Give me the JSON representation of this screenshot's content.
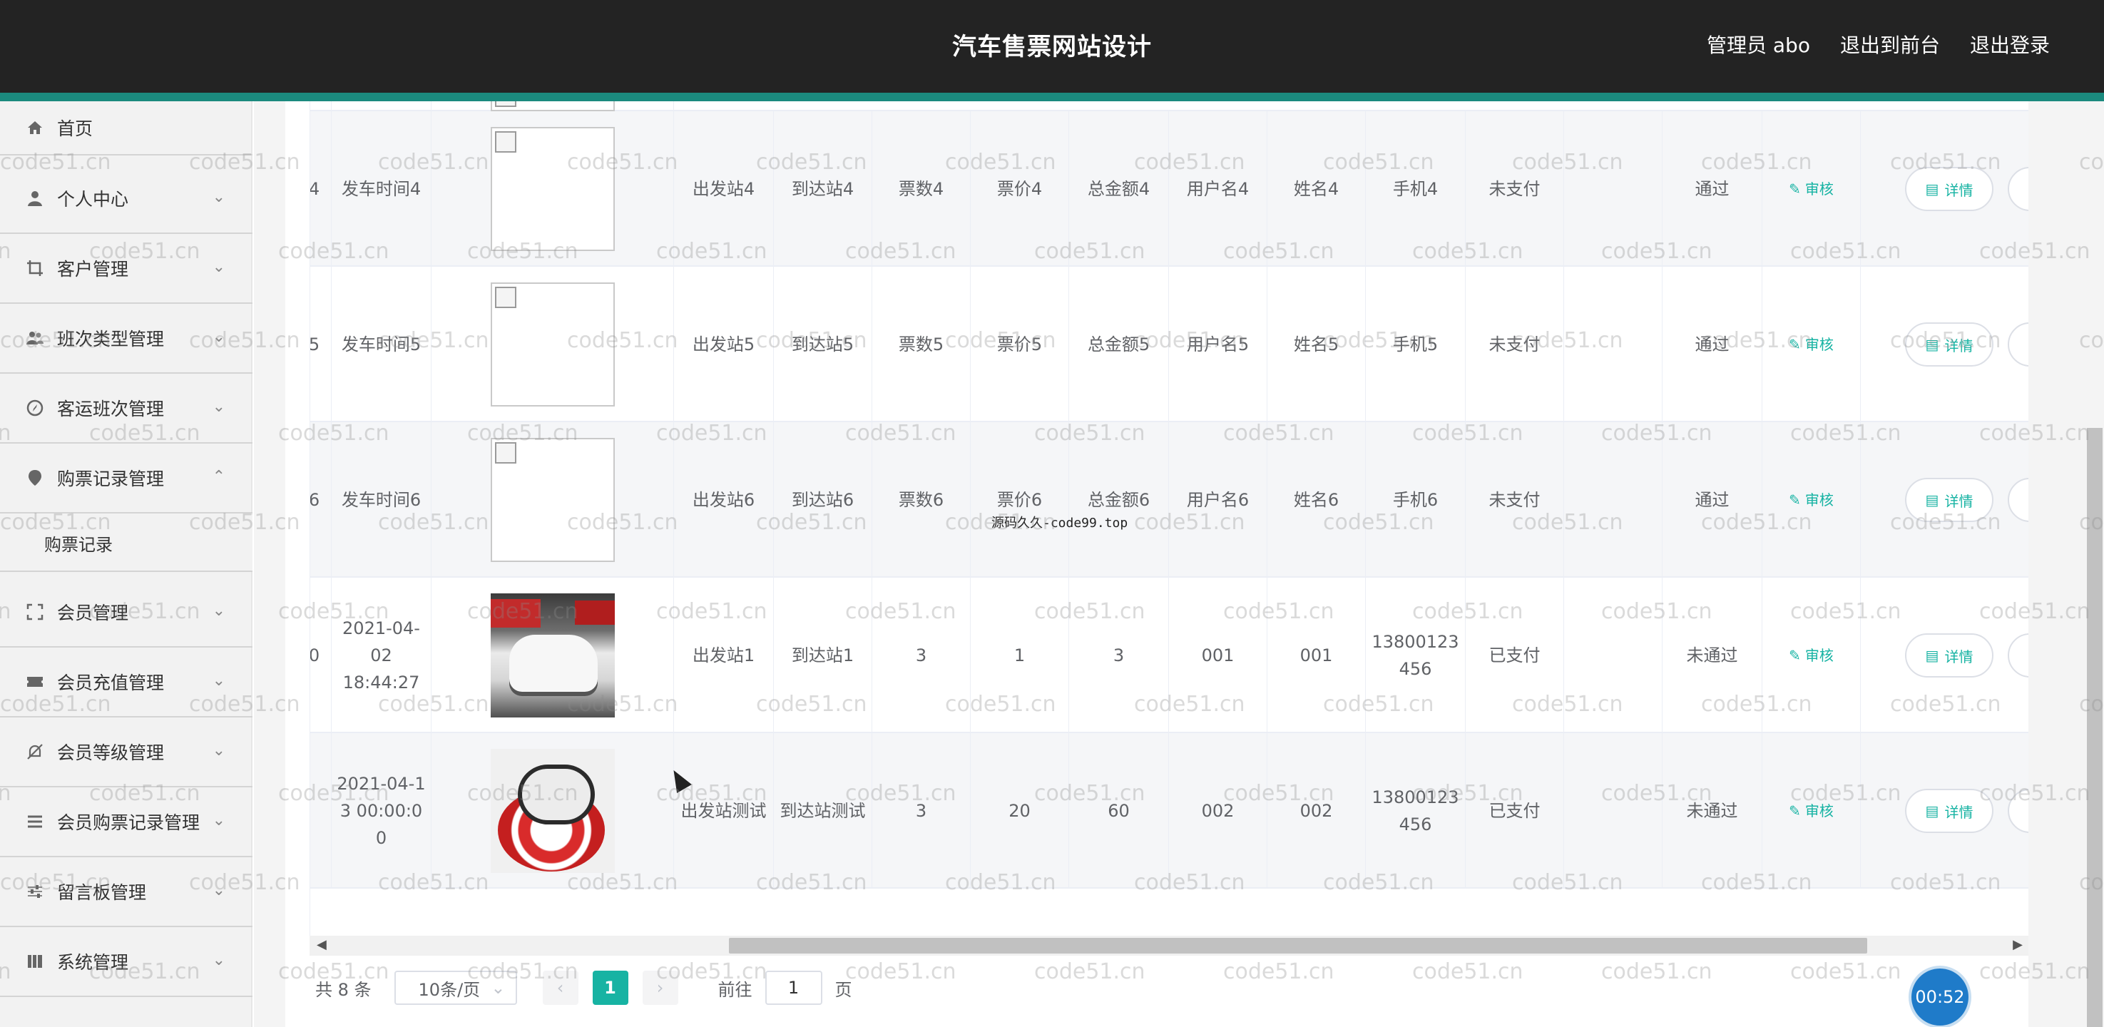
{
  "header": {
    "title": "汽车售票网站设计",
    "admin_label": "管理员 abo",
    "back_to_front": "退出到前台",
    "logout": "退出登录"
  },
  "sidebar": {
    "items": [
      {
        "label": "首页",
        "icon": "home-icon"
      },
      {
        "label": "个人中心",
        "icon": "user-icon"
      },
      {
        "label": "客户管理",
        "icon": "crop-icon"
      },
      {
        "label": "班次类型管理",
        "icon": "users-icon"
      },
      {
        "label": "客运班次管理",
        "icon": "compass-icon"
      },
      {
        "label": "购票记录管理",
        "icon": "pin-icon"
      },
      {
        "label": "会员管理",
        "icon": "fullscreen-icon"
      },
      {
        "label": "会员充值管理",
        "icon": "ticket-icon"
      },
      {
        "label": "会员等级管理",
        "icon": "bell-off-icon"
      },
      {
        "label": "会员购票记录管理",
        "icon": "list-icon"
      },
      {
        "label": "留言板管理",
        "icon": "sliders-icon"
      },
      {
        "label": "系统管理",
        "icon": "grid-icon"
      }
    ],
    "submenu": {
      "label": "购票记录"
    }
  },
  "table": {
    "rows": [
      {
        "num": "4",
        "time": "发车时间4",
        "img": "broken",
        "from": "出发站4",
        "to": "到达站4",
        "count": "票数4",
        "price": "票价4",
        "total": "总金额4",
        "user": "用户名4",
        "name": "姓名4",
        "phone": "手机4",
        "pay": "未支付",
        "review": "通过"
      },
      {
        "num": "5",
        "time": "发车时间5",
        "img": "broken",
        "from": "出发站5",
        "to": "到达站5",
        "count": "票数5",
        "price": "票价5",
        "total": "总金额5",
        "user": "用户名5",
        "name": "姓名5",
        "phone": "手机5",
        "pay": "未支付",
        "review": "通过"
      },
      {
        "num": "6",
        "time": "发车时间6",
        "img": "broken",
        "from": "出发站6",
        "to": "到达站6",
        "count": "票数6",
        "price": "票价6",
        "total": "总金额6",
        "user": "用户名6",
        "name": "姓名6",
        "phone": "手机6",
        "pay": "未支付",
        "review": "通过"
      },
      {
        "num": "0",
        "time": "2021-04-02 18:44:27",
        "img": "car1",
        "from": "出发站1",
        "to": "到达站1",
        "count": "3",
        "price": "1",
        "total": "3",
        "user": "001",
        "name": "001",
        "phone": "13800123456",
        "pay": "已支付",
        "review": "未通过"
      },
      {
        "num": "",
        "time": "2021-04-13 00:00:00",
        "img": "car2",
        "from": "出发站测试",
        "to": "到达站测试",
        "count": "3",
        "price": "20",
        "total": "60",
        "user": "002",
        "name": "002",
        "phone": "13800123456",
        "pay": "已支付",
        "review": "未通过"
      }
    ],
    "audit_label": "审核",
    "detail_label": "详情"
  },
  "overlay_text": "源码久久-code99.top",
  "pagination": {
    "total": "共 8 条",
    "page_size": "10条/页",
    "current": "1",
    "goto_label": "前往",
    "goto_value": "1",
    "page_unit": "页"
  },
  "timer": "00:52",
  "watermark": "code51.cn"
}
